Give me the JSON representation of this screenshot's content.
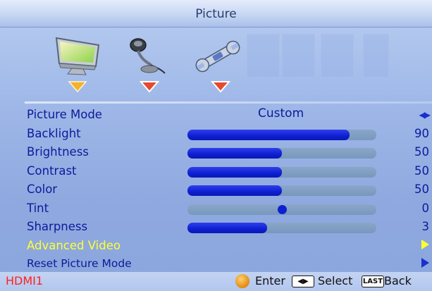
{
  "header": {
    "title": "Picture"
  },
  "icons": [
    {
      "name": "picture-icon",
      "selected": true
    },
    {
      "name": "audio-icon",
      "selected": false
    },
    {
      "name": "setup-icon",
      "selected": false
    }
  ],
  "menu": {
    "picture_mode": {
      "label": "Picture Mode",
      "value": "Custom"
    },
    "backlight": {
      "label": "Backlight",
      "value": "90",
      "level": 0.86
    },
    "brightness": {
      "label": "Brightness",
      "value": "50",
      "level": 0.5
    },
    "contrast": {
      "label": "Contrast",
      "value": "50",
      "level": 0.5
    },
    "color": {
      "label": "Color",
      "value": "50",
      "level": 0.5
    },
    "tint": {
      "label": "Tint",
      "value": "0",
      "level": 0.5
    },
    "sharpness": {
      "label": "Sharpness",
      "value": "3",
      "level": 0.42
    },
    "advanced_video": {
      "label": "Advanced Video"
    },
    "reset_picture_mode": {
      "label": "Reset Picture Mode"
    }
  },
  "footer": {
    "input": "HDMI1",
    "enter": "Enter",
    "select": "Select",
    "last_key": "LAST",
    "back": "Back"
  },
  "colors": {
    "label": "#0d1a9a",
    "selected_label": "#ffff33",
    "slider_fill": "#0d1fd2",
    "input_label": "#ff2020",
    "accent": "#f0a020"
  }
}
